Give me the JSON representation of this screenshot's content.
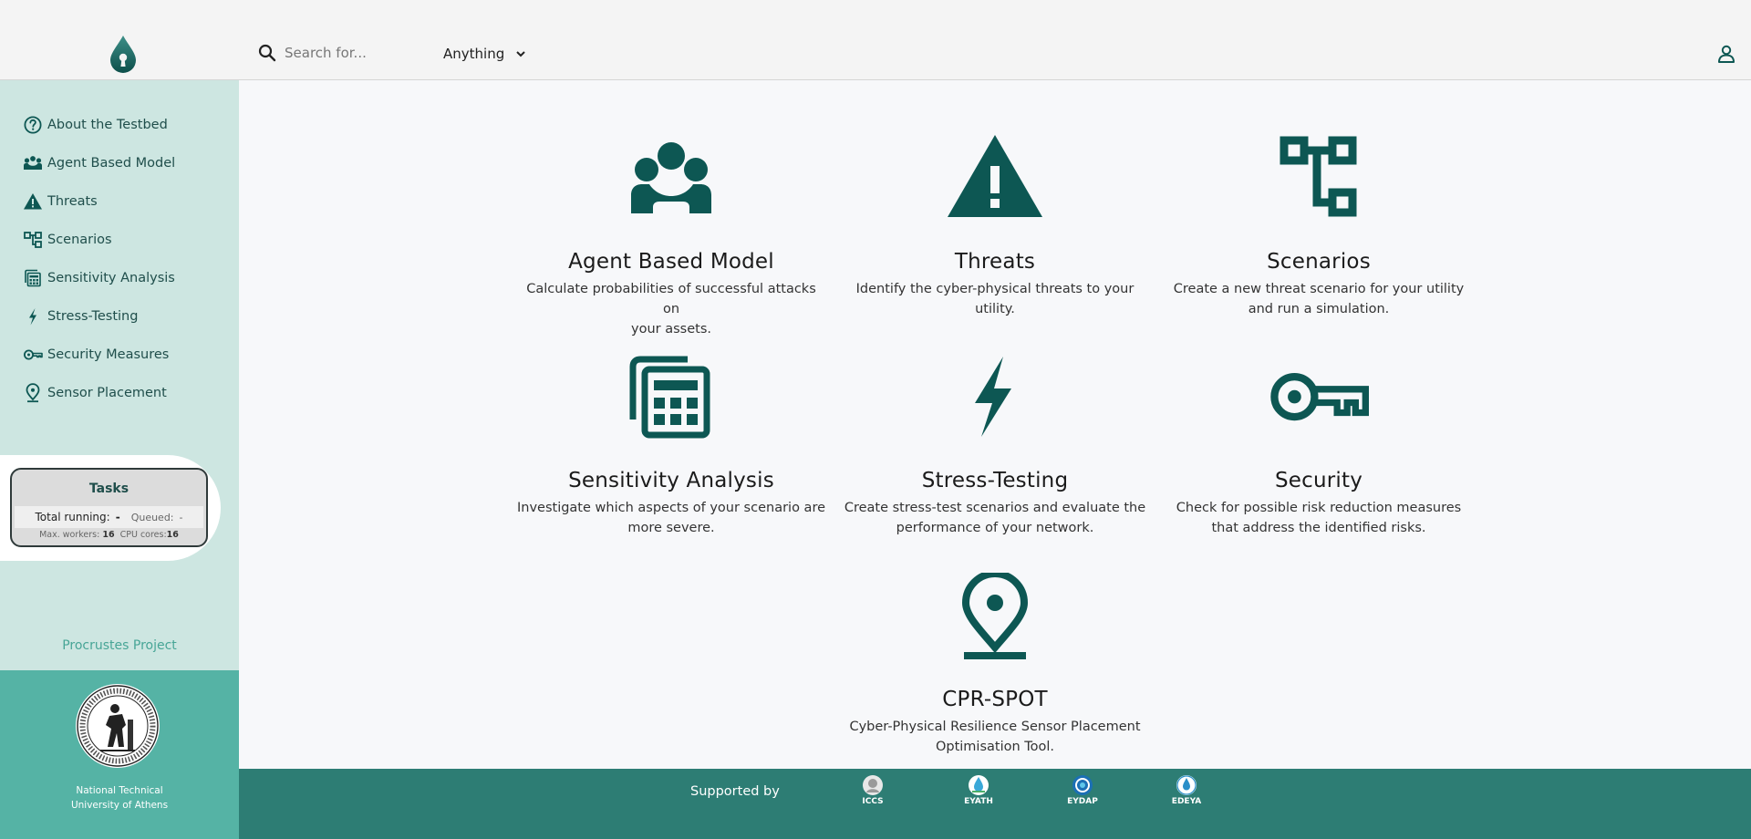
{
  "header": {
    "search_placeholder": "Search for...",
    "scope_value": "Anything"
  },
  "sidebar": {
    "items": [
      {
        "label": "About the Testbed",
        "icon": "question-circle-icon"
      },
      {
        "label": "Agent Based Model",
        "icon": "people-icon"
      },
      {
        "label": "Threats",
        "icon": "warning-icon"
      },
      {
        "label": "Scenarios",
        "icon": "tree-icon"
      },
      {
        "label": "Sensitivity Analysis",
        "icon": "calculator-icon"
      },
      {
        "label": "Stress-Testing",
        "icon": "lightning-icon"
      },
      {
        "label": "Security Measures",
        "icon": "key-icon"
      },
      {
        "label": "Sensor Placement",
        "icon": "location-pin-icon"
      }
    ],
    "tasks": {
      "title": "Tasks",
      "total_running_label": "Total running:",
      "total_running_value": "-",
      "queued_label": "Queued:",
      "queued_value": "-",
      "max_workers_label": "Max. workers:",
      "max_workers_value": "16",
      "cpu_cores_label": "CPU cores:",
      "cpu_cores_value": "16"
    },
    "project_link": "Procrustes Project",
    "university": {
      "line1": "National Technical",
      "line2": "University of Athens"
    }
  },
  "cards": [
    {
      "title": "Agent Based Model",
      "line1": "Calculate probabilities of successful attacks on",
      "line2": "your assets.",
      "icon": "people-icon"
    },
    {
      "title": "Threats",
      "line1": "Identify the cyber-physical threats to your",
      "line2": "utility.",
      "icon": "warning-icon"
    },
    {
      "title": "Scenarios",
      "line1": "Create a new threat scenario for your utility",
      "line2": "and run a simulation.",
      "icon": "tree-icon"
    },
    {
      "title": "Sensitivity Analysis",
      "line1": "Investigate which aspects of your scenario are",
      "line2": "more severe.",
      "icon": "calculator-icon"
    },
    {
      "title": "Stress-Testing",
      "line1": "Create stress-test scenarios and evaluate the",
      "line2": "performance of your network.",
      "icon": "lightning-icon"
    },
    {
      "title": "Security",
      "line1": "Check for possible risk reduction measures",
      "line2": "that address the identified risks.",
      "icon": "key-icon"
    },
    {
      "title": "CPR-SPOT",
      "line1": "Cyber-Physical Resilience Sensor Placement",
      "line2": "Optimisation Tool.",
      "icon": "location-pin-icon"
    }
  ],
  "footer": {
    "supported_by": "Supported by",
    "partners": [
      "ICCS",
      "EYATH",
      "EYDAP",
      "EDEYA"
    ]
  },
  "colors": {
    "accent": "#0d5753",
    "sidebar_bg": "#cde6e1",
    "footer_bg": "#2d7d74",
    "university_bg": "#55b3a5",
    "link": "#47a596"
  }
}
